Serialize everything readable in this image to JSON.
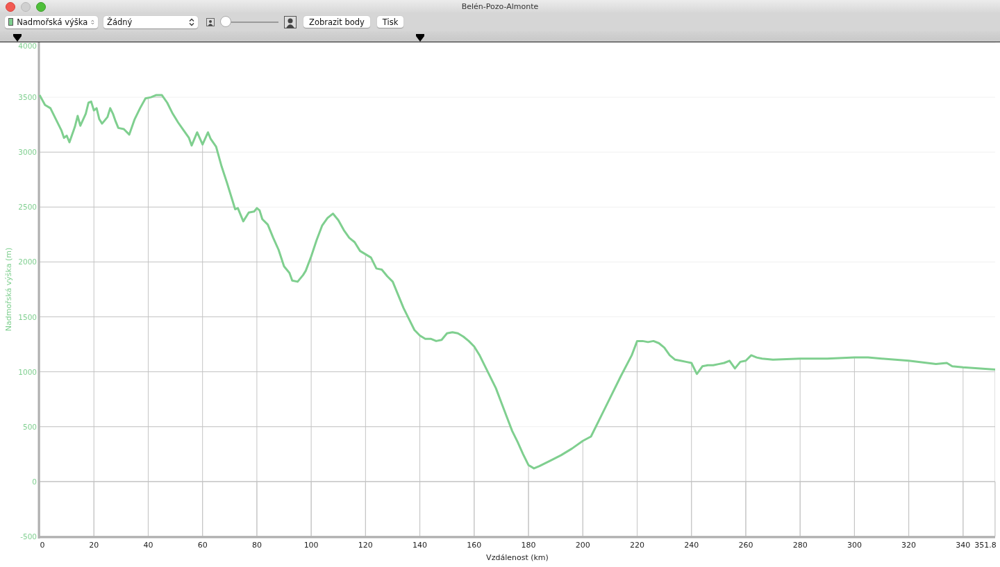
{
  "window": {
    "title": "Belén-Pozo-Almonte"
  },
  "toolbar": {
    "overlay_select": {
      "value": "Žádný"
    },
    "zoom_slider": {
      "level": 0
    },
    "buttons": [
      "Zobrazit body",
      "Tisk"
    ]
  },
  "chart": {
    "chart_data": {
      "type": "line",
      "xlabel": "Vzdálenost (km)",
      "ylabel": "Nadmořská výška (m)",
      "x": [
        0,
        2,
        4,
        6,
        8,
        9,
        10,
        11,
        13,
        14,
        15,
        17,
        18,
        19,
        20,
        21,
        22,
        23,
        25,
        26,
        27,
        28,
        29,
        31,
        33,
        35,
        37,
        39,
        41,
        43,
        45,
        47,
        49,
        51,
        53,
        55,
        56,
        58,
        60,
        62,
        63,
        65,
        67,
        69,
        71,
        72,
        73,
        75,
        77,
        79,
        80,
        81,
        82,
        84,
        86,
        88,
        90,
        92,
        93,
        95,
        97,
        98,
        100,
        102,
        104,
        106,
        108,
        110,
        112,
        114,
        116,
        118,
        120,
        122,
        124,
        126,
        128,
        130,
        132,
        134,
        136,
        138,
        140,
        142,
        144,
        146,
        148,
        150,
        152,
        154,
        156,
        158,
        160,
        162,
        164,
        166,
        168,
        170,
        172,
        174,
        176,
        178,
        180,
        182,
        184,
        188,
        192,
        196,
        200,
        203,
        206,
        210,
        214,
        218,
        220,
        222,
        224,
        226,
        228,
        230,
        232,
        234,
        236,
        238,
        240,
        242,
        244,
        246,
        248,
        250,
        252,
        254,
        256,
        258,
        260,
        262,
        264,
        266,
        270,
        280,
        290,
        300,
        305,
        310,
        320,
        330,
        334,
        336,
        340,
        351.8
      ],
      "series": [
        {
          "name": "Nadmořská výška",
          "color": "#7fcf8f",
          "values": [
            3520,
            3430,
            3400,
            3300,
            3200,
            3130,
            3150,
            3090,
            3230,
            3330,
            3240,
            3350,
            3450,
            3460,
            3380,
            3400,
            3300,
            3260,
            3320,
            3400,
            3350,
            3280,
            3220,
            3210,
            3160,
            3300,
            3400,
            3490,
            3500,
            3520,
            3520,
            3450,
            3350,
            3270,
            3200,
            3130,
            3060,
            3180,
            3070,
            3180,
            3120,
            3050,
            2870,
            2720,
            2560,
            2480,
            2490,
            2370,
            2450,
            2460,
            2490,
            2470,
            2390,
            2340,
            2220,
            2110,
            1960,
            1900,
            1830,
            1820,
            1880,
            1920,
            2050,
            2200,
            2330,
            2400,
            2440,
            2380,
            2290,
            2220,
            2180,
            2100,
            2070,
            2040,
            1940,
            1930,
            1870,
            1820,
            1700,
            1580,
            1480,
            1380,
            1330,
            1300,
            1300,
            1280,
            1290,
            1350,
            1360,
            1350,
            1320,
            1280,
            1230,
            1150,
            1050,
            950,
            850,
            720,
            590,
            460,
            360,
            250,
            150,
            120,
            140,
            190,
            240,
            300,
            370,
            410,
            560,
            760,
            960,
            1150,
            1280,
            1280,
            1270,
            1280,
            1260,
            1220,
            1150,
            1110,
            1100,
            1090,
            1080,
            980,
            1050,
            1060,
            1060,
            1070,
            1080,
            1100,
            1030,
            1090,
            1100,
            1150,
            1130,
            1120,
            1110,
            1120,
            1120,
            1130,
            1130,
            1120,
            1100,
            1070,
            1080,
            1050,
            1040,
            1020
          ]
        }
      ],
      "grid": true,
      "xlim": [
        0,
        351.8
      ],
      "ylim": [
        -500,
        4000
      ],
      "xticks": [
        0,
        20,
        40,
        60,
        80,
        100,
        120,
        140,
        160,
        180,
        200,
        220,
        240,
        260,
        280,
        300,
        320,
        340,
        {
          "value": 351.8,
          "label": "351.8"
        }
      ],
      "yticks": [
        -500,
        0,
        500,
        1000,
        1500,
        2000,
        2500,
        3000,
        3500,
        4000
      ]
    }
  }
}
